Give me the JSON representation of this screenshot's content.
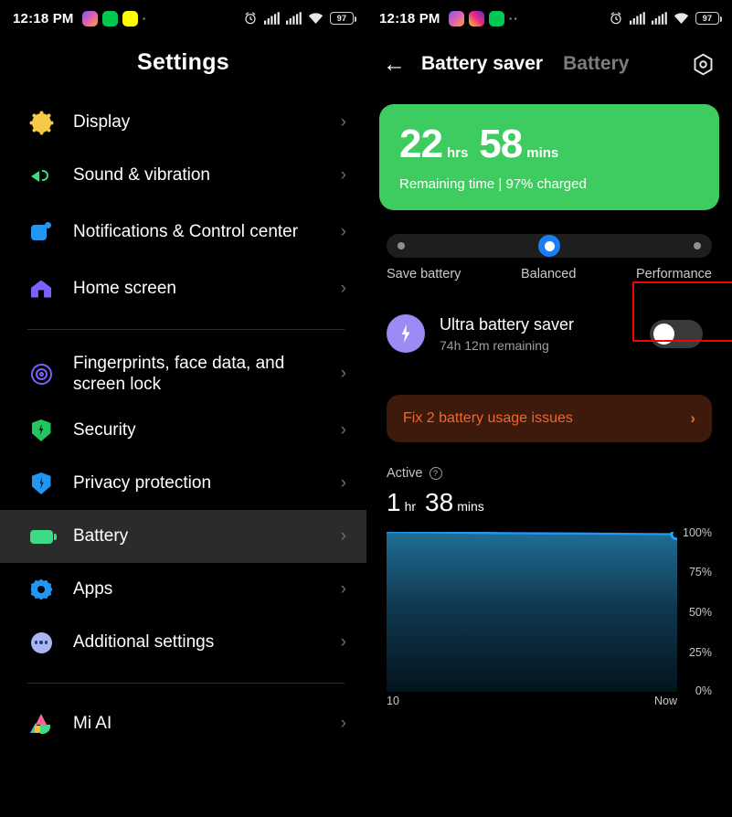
{
  "status_bar_left": {
    "time": "12:18 PM",
    "app_icons": [
      "messenger-icon",
      "spotify-icon",
      "snapchat-icon"
    ],
    "overflow": "·",
    "right_icons": [
      "alarm-icon",
      "signal-1-icon",
      "signal-2-icon",
      "wifi-icon"
    ],
    "battery_level": "97"
  },
  "status_bar_right": {
    "time": "12:18 PM",
    "app_icons": [
      "messenger-icon",
      "instagram-icon",
      "spotify-icon"
    ],
    "overflow": "··",
    "right_icons": [
      "alarm-icon",
      "signal-1-icon",
      "signal-2-icon",
      "wifi-icon"
    ],
    "battery_level": "97"
  },
  "settings_pane": {
    "title": "Settings",
    "items": [
      {
        "label": "Display",
        "icon": "brightness-sun-icon",
        "chevron": "›",
        "active": false
      },
      {
        "label": "Sound & vibration",
        "icon": "speaker-icon",
        "chevron": "›",
        "active": false
      },
      {
        "label": "Notifications & Control center",
        "icon": "notifications-icon",
        "chevron": "›",
        "active": false
      },
      {
        "label": "Home screen",
        "icon": "home-icon",
        "chevron": "›",
        "active": false
      },
      {
        "label": "Fingerprints, face data, and screen lock",
        "icon": "fingerprint-icon",
        "chevron": "›",
        "active": false
      },
      {
        "label": "Security",
        "icon": "shield-icon",
        "chevron": "›",
        "active": false
      },
      {
        "label": "Privacy protection",
        "icon": "privacy-shield-icon",
        "chevron": "›",
        "active": false
      },
      {
        "label": "Battery",
        "icon": "battery-icon",
        "chevron": "›",
        "active": true
      },
      {
        "label": "Apps",
        "icon": "apps-gear-icon",
        "chevron": "›",
        "active": false
      },
      {
        "label": "Additional settings",
        "icon": "more-dots-icon",
        "chevron": "›",
        "active": false
      },
      {
        "label": "Mi AI",
        "icon": "mi-ai-icon",
        "chevron": "›",
        "active": false
      }
    ]
  },
  "battery_pane": {
    "back_icon": "back-arrow-icon",
    "title": "Battery saver",
    "tab_secondary": "Battery",
    "gear_icon": "settings-hex-icon",
    "summary_card": {
      "hours": "22",
      "hours_unit": "hrs",
      "minutes": "58",
      "minutes_unit": "mins",
      "subtitle": "Remaining time | 97% charged",
      "bg_color": "#3ecc60"
    },
    "mode_selector": {
      "options": [
        "Save battery",
        "Balanced",
        "Performance"
      ],
      "selected": "Balanced",
      "selected_index": 1,
      "accent_color": "#1a7ef5"
    },
    "ultra_battery_saver": {
      "title": "Ultra battery saver",
      "subtitle": "74h 12m remaining",
      "icon": "bolt-icon",
      "toggle_state": "off",
      "highlighted": true,
      "highlight_color": "#ff0000"
    },
    "fix_banner": {
      "label": "Fix 2 battery usage issues",
      "chevron": "›",
      "text_color": "#f4662a",
      "bg_color": "#3d1a0c"
    },
    "active_section": {
      "label": "Active",
      "help_icon": "question-icon",
      "hours": "1",
      "hours_unit": "hr",
      "minutes": "38",
      "minutes_unit": "mins"
    }
  },
  "chart_data": {
    "type": "area",
    "title": "Battery level history",
    "xlabel": "",
    "ylabel": "",
    "line_color": "#2196f3",
    "fill_top_color": "#1b5a80",
    "fill_bottom_color": "#04131c",
    "grid": true,
    "ylim": [
      0,
      100
    ],
    "y_ticks": [
      "0%",
      "25%",
      "50%",
      "75%",
      "100%"
    ],
    "y_tick_values": [
      0,
      25,
      50,
      75,
      100
    ],
    "x_ticks": [
      "10",
      "Now"
    ],
    "x": [
      0,
      10,
      20,
      30,
      40,
      50,
      60,
      70,
      80,
      90,
      100
    ],
    "values": [
      100,
      99.8,
      99.6,
      99.4,
      99.2,
      99.1,
      99.0,
      98.9,
      98.8,
      98.6,
      98.5
    ],
    "end_marker": {
      "x": 100,
      "y": 98.5,
      "label": ""
    }
  }
}
